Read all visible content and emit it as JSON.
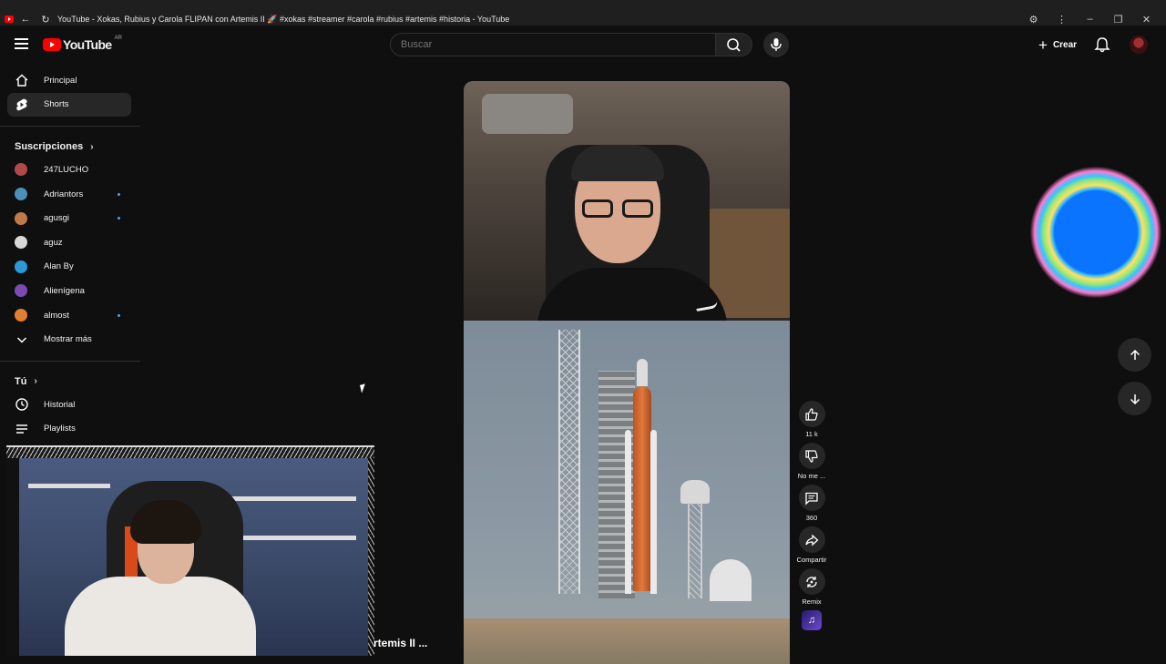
{
  "browser": {
    "tab_title": "YouTube - Xokas, Rubius y Carola FLIPAN con Artemis II 🚀 #xokas #streamer #carola #rubius #artemis #historia - YouTube"
  },
  "masthead": {
    "country": "AR",
    "logo_text": "YouTube",
    "search_placeholder": "Buscar",
    "create_label": "Crear"
  },
  "sidebar": {
    "main": [
      {
        "label": "Principal",
        "icon": "home-icon"
      },
      {
        "label": "Shorts",
        "icon": "shorts-icon",
        "active": true
      }
    ],
    "subscriptions_title": "Suscripciones",
    "subscriptions": [
      {
        "label": "247LUCHO",
        "color": "#b04a4a",
        "new": false
      },
      {
        "label": "Adriantors",
        "color": "#4a90b8",
        "new": true
      },
      {
        "label": "agusgi",
        "color": "#c07a4a",
        "new": true
      },
      {
        "label": "aguz",
        "color": "#d8d8d8",
        "new": false
      },
      {
        "label": "Alan By",
        "color": "#2a9ad8",
        "new": false
      },
      {
        "label": "Alienígena",
        "color": "#7a4ab0",
        "new": false
      },
      {
        "label": "almost",
        "color": "#e08030",
        "new": true
      }
    ],
    "show_more": "Mostrar más",
    "you_title": "Tú",
    "you_items": [
      {
        "label": "Historial",
        "icon": "history-icon"
      },
      {
        "label": "Playlists",
        "icon": "playlists-icon"
      }
    ]
  },
  "short_actions": {
    "like_count": "11 k",
    "dislike_label": "No me ...",
    "comment_count": "360",
    "share_label": "Compartir",
    "remix_label": "Remix"
  },
  "overlay": {
    "caption": "rtemis II ..."
  },
  "colors": {
    "background": "#0f0f0f",
    "accent_red": "#ff0000",
    "new_dot": "#3ea6ff"
  }
}
